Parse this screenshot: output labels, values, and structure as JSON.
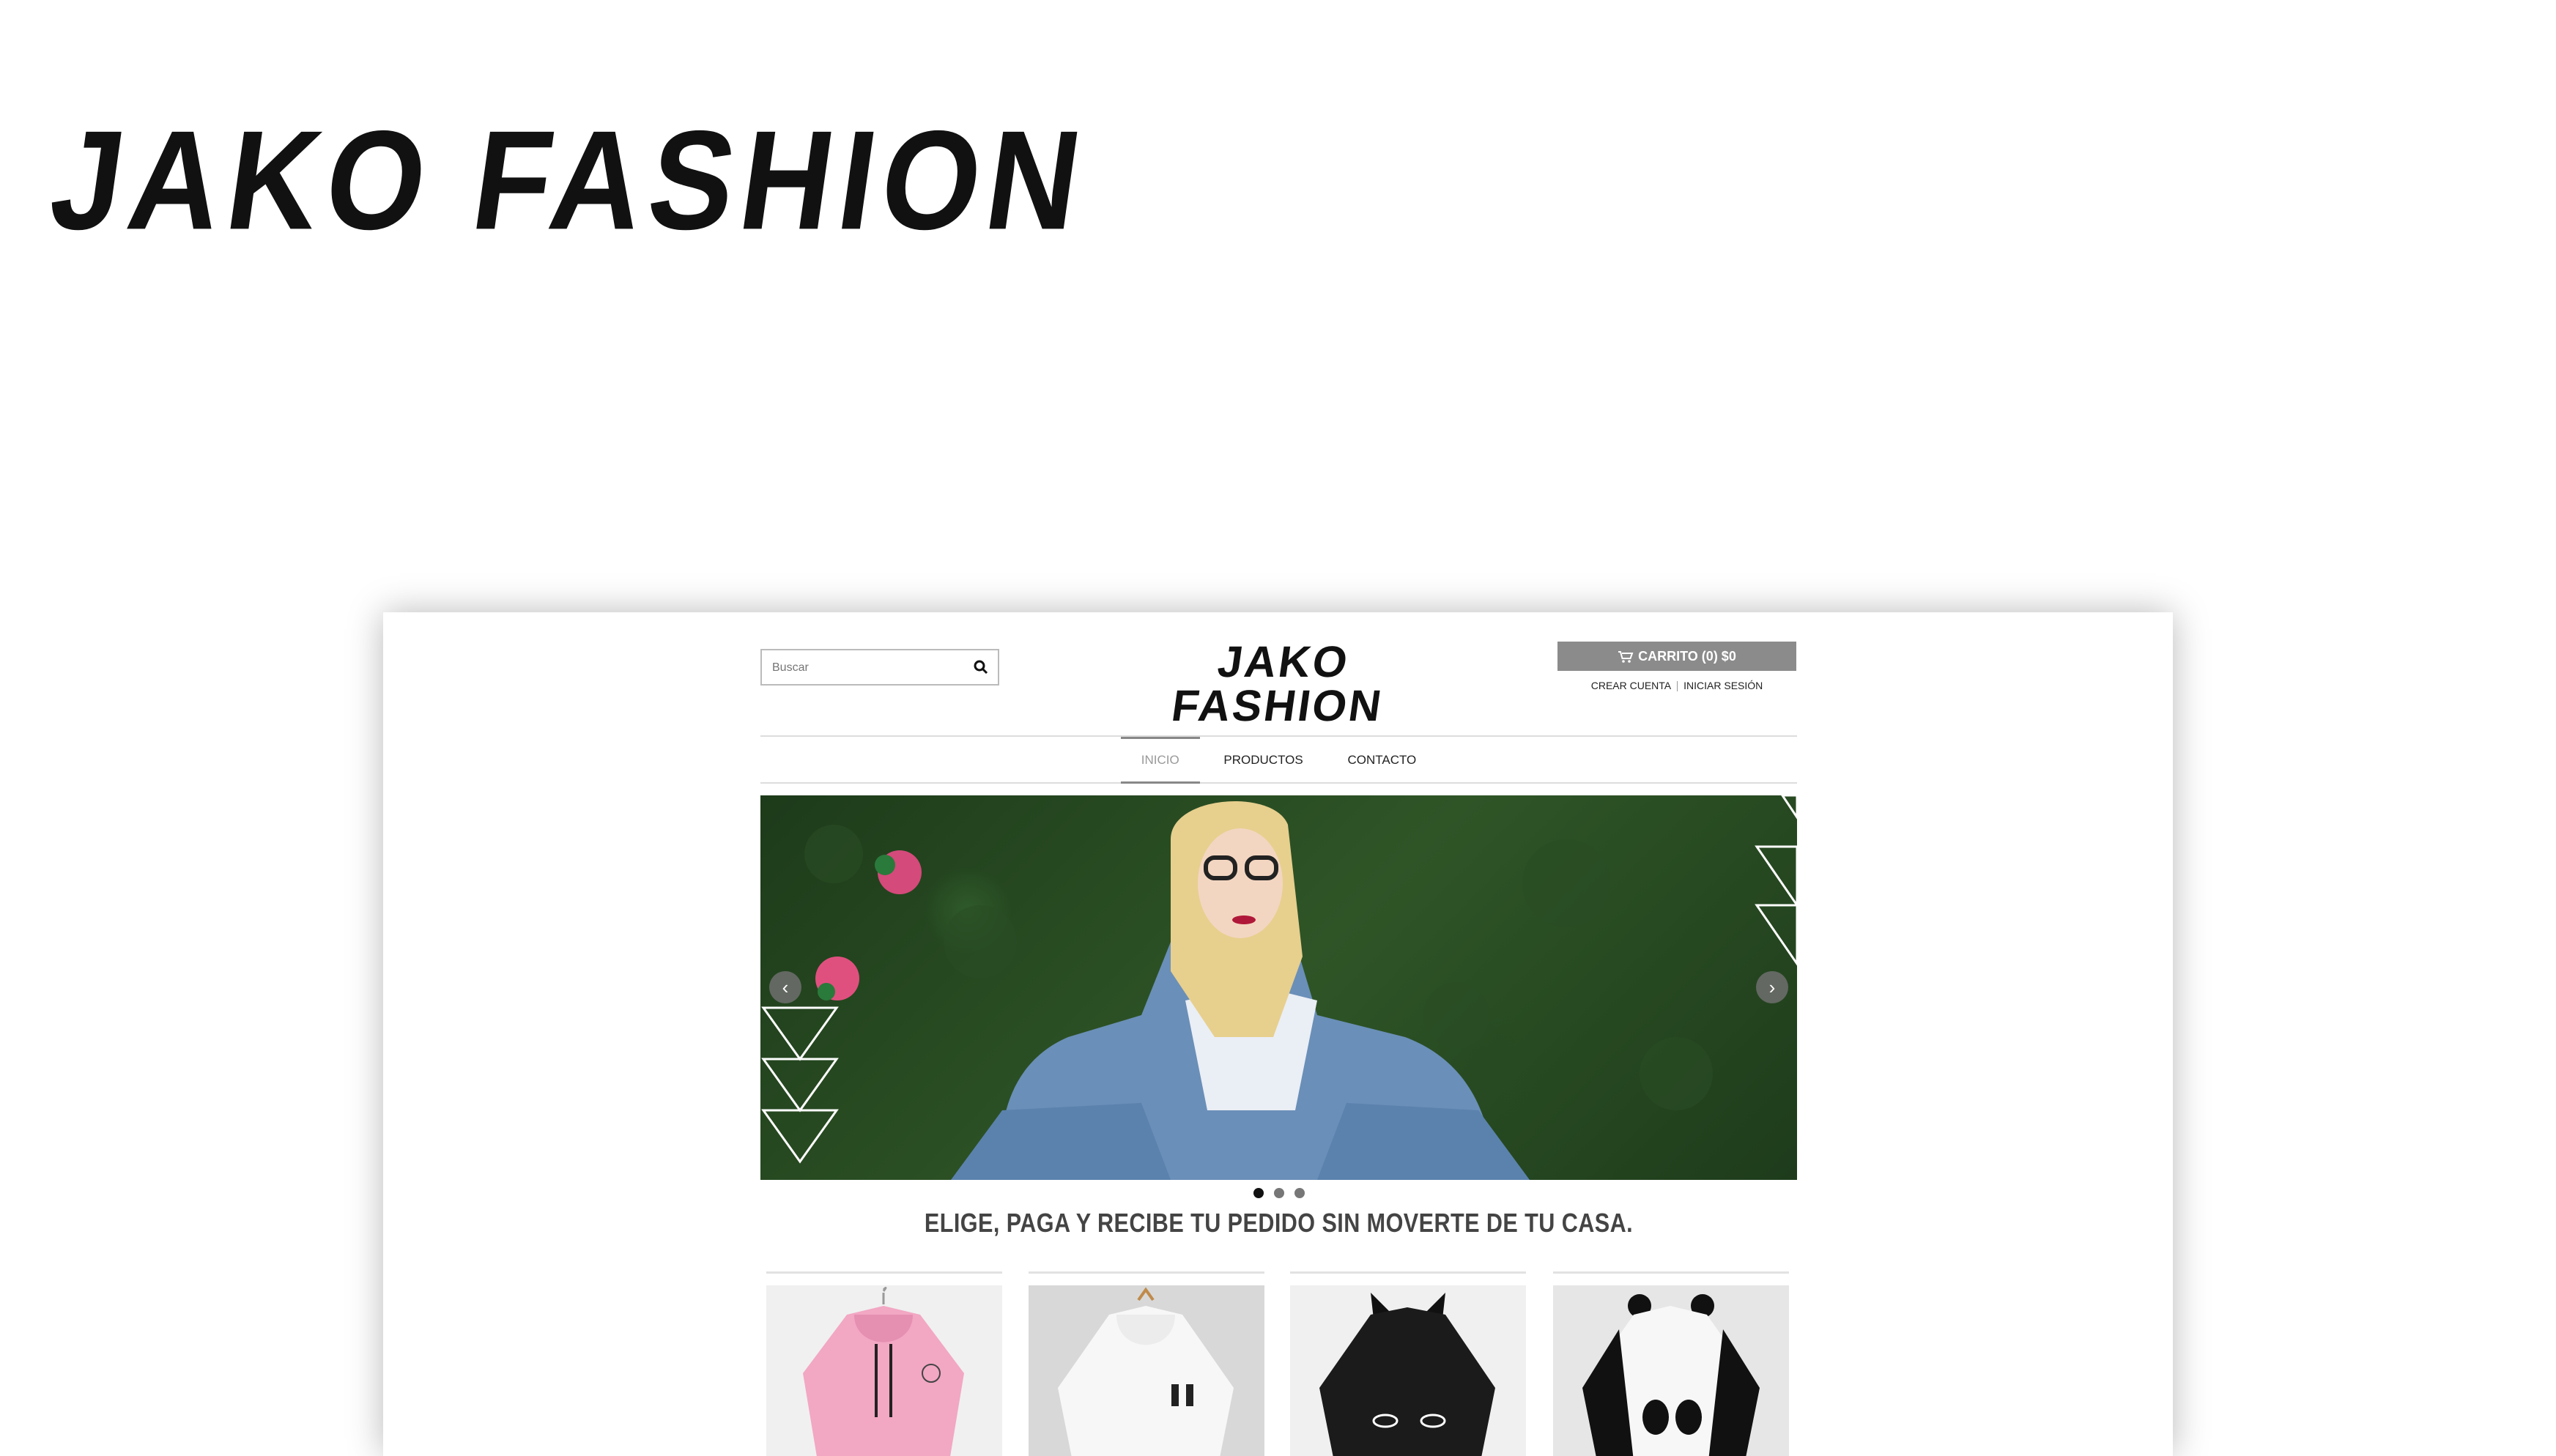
{
  "banner": {
    "brand": "JAKO FASHION"
  },
  "header": {
    "search_placeholder": "Buscar",
    "logo": "JAKO FASHION",
    "cart_label": "CARRITO (0) $0",
    "create_account": "CREAR CUENTA",
    "login": "INICIAR SESIÓN"
  },
  "nav": {
    "items": [
      "INICIO",
      "PRODUCTOS",
      "CONTACTO"
    ],
    "active": "INICIO"
  },
  "slider": {
    "slides": 3,
    "active_slide": 1
  },
  "slogan": "ELIGE, PAGA Y RECIBE TU PEDIDO SIN MOVERTE DE TU CASA.",
  "products": [
    {
      "icon": "pink-hoodie-icon",
      "color": "#f2a7c3"
    },
    {
      "icon": "white-hoodie-icon",
      "color": "#f4f4f4"
    },
    {
      "icon": "black-cat-hoodie-icon",
      "color": "#1b1b1b"
    },
    {
      "icon": "panda-hoodie-icon",
      "color": "#f7f7f7"
    }
  ],
  "colors": {
    "cart_bg": "#8b8b8b",
    "text": "#222222"
  }
}
